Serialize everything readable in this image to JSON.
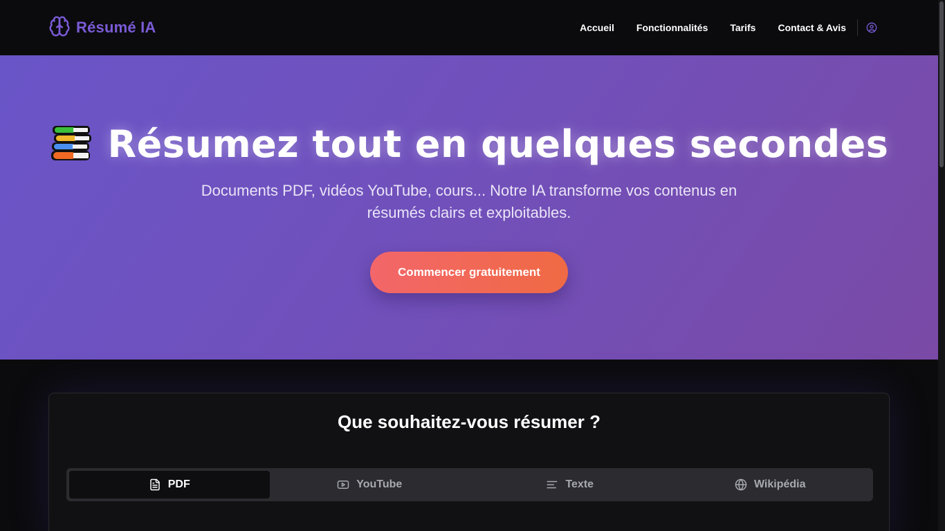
{
  "brand": {
    "name": "Résumé IA",
    "accent": "#7b5bd8"
  },
  "nav": {
    "items": [
      "Accueil",
      "Fonctionnalités",
      "Tarifs",
      "Contact & Avis"
    ],
    "account_icon": "user-circle-icon"
  },
  "hero": {
    "emoji_icon": "books-icon",
    "title": "Résumez tout en quelques secondes",
    "subtitle": "Documents PDF, vidéos YouTube, cours... Notre IA transforme vos contenus en résumés clairs et exploitables.",
    "cta_label": "Commencer gratuitement",
    "gradient_start": "#6a55c8",
    "gradient_end": "#7a4aa6"
  },
  "summarize": {
    "heading": "Que souhaitez-vous résumer ?",
    "tabs": [
      {
        "label": "PDF",
        "icon": "file-text-icon",
        "active": true
      },
      {
        "label": "YouTube",
        "icon": "youtube-icon",
        "active": false
      },
      {
        "label": "Texte",
        "icon": "align-left-icon",
        "active": false
      },
      {
        "label": "Wikipédia",
        "icon": "globe-icon",
        "active": false
      }
    ]
  }
}
